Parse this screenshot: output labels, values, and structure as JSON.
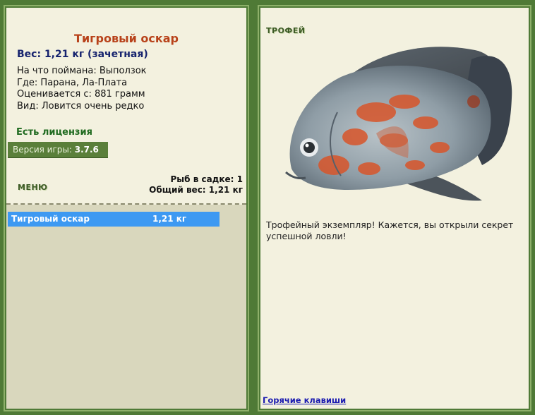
{
  "fish": {
    "title": "Тигровый оскар",
    "weight_line": "Вес: 1,21 кг (зачетная)",
    "info": [
      "На что поймана: Выползок",
      "Где: Парана, Ла-Плата",
      "Оценивается с: 881 грамм",
      "Вид: Ловится очень редко"
    ]
  },
  "license": "Есть лицензия",
  "version": {
    "label": "Версия игры:",
    "value": "3.7.6"
  },
  "menu_label": "МЕНЮ",
  "stats": {
    "count": "Рыб в садке: 1",
    "total": "Общий вес: 1,21 кг"
  },
  "catch_list": [
    {
      "name": "Тигровый оскар",
      "weight": "1,21 кг"
    }
  ],
  "trophy": {
    "label": "ТРОФЕЙ",
    "text": "Трофейный экземпляр! Кажется, вы открыли секрет успешной ловли!"
  },
  "hotkeys_link": "Горячие клавиши",
  "colors": {
    "frame_green": "#4f7a36",
    "panel_bg": "#f3f1df",
    "title_orange": "#b8421a",
    "weight_navy": "#16236e",
    "license_green": "#1f6a1f",
    "selection_blue": "#3d99f2"
  }
}
